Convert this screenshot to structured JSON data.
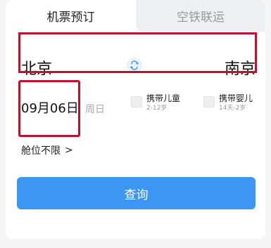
{
  "tabs": [
    {
      "label": "机票预订",
      "active": true
    },
    {
      "label": "空铁联运",
      "active": false
    }
  ],
  "route": {
    "from_city": "北京",
    "to_city": "南京",
    "swap_icon": "swap-arrows-icon"
  },
  "date": {
    "value": "09月06日",
    "weekday": "周日"
  },
  "passengers": {
    "child": {
      "label": "携带儿童",
      "age_range": "2-12岁",
      "checked": false
    },
    "infant": {
      "label": "携带婴儿",
      "age_range": "14天-2岁",
      "checked": false
    }
  },
  "cabin": {
    "label": "舱位不限",
    "chevron": ">"
  },
  "search_button": {
    "label": "查询"
  },
  "colors": {
    "accent": "#3c97f2",
    "highlight": "#c3102e",
    "inactive_tab_bg": "#eef0f2"
  }
}
